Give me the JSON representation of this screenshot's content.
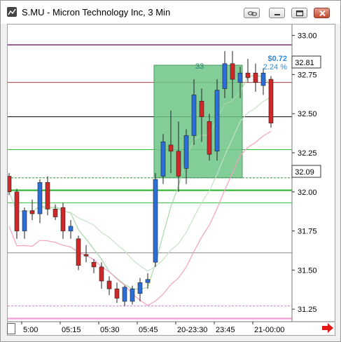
{
  "window": {
    "title": "S.MU - Micron Technology Inc, 3 Min"
  },
  "titlebar_buttons": [
    {
      "name": "link-icon-button",
      "icon": "chain-link-icon"
    },
    {
      "name": "minimize-button",
      "icon": "minimize-icon"
    },
    {
      "name": "maximize-button",
      "icon": "maximize-icon"
    },
    {
      "name": "close-button",
      "icon": "close-icon"
    }
  ],
  "colors": {
    "up_candle": "#2a6fd8",
    "down_candle": "#d02828",
    "box_fill": "#6cc486",
    "current_price_bg": "#ffffff",
    "price_badge_bg": "#3c3c3c",
    "nav_arrow": "#e01818",
    "info_text": "#2a8be0"
  },
  "price_axis": {
    "ticks": [
      "33.00",
      "32.75",
      "32.50",
      "32.25",
      "32.00",
      "31.75",
      "31.50",
      "31.25"
    ]
  },
  "time_axis": {
    "ticks": [
      "5:00",
      "05:15",
      "05:30",
      "05:45",
      "20-23:30",
      "23:45",
      "21-00:00"
    ]
  },
  "labels": {
    "current_price": "32.81",
    "level_price": "32.09",
    "box_bar_count": "33",
    "change_dollar": "$0.72",
    "change_percent": "2.24 %"
  },
  "chart_data": {
    "type": "candlestick",
    "symbol": "S.MU",
    "interval": "3 Min",
    "ylim": [
      31.17,
      33.07
    ],
    "candles": [
      {
        "o": 32.1,
        "h": 32.12,
        "l": 31.98,
        "c": 32.0
      },
      {
        "o": 32.0,
        "h": 32.02,
        "l": 31.7,
        "c": 31.75
      },
      {
        "o": 31.75,
        "h": 31.9,
        "l": 31.7,
        "c": 31.88
      },
      {
        "o": 31.88,
        "h": 31.95,
        "l": 31.82,
        "c": 31.86
      },
      {
        "o": 31.86,
        "h": 32.08,
        "l": 31.8,
        "c": 32.06
      },
      {
        "o": 32.06,
        "h": 32.1,
        "l": 31.85,
        "c": 31.89
      },
      {
        "o": 31.89,
        "h": 31.92,
        "l": 31.82,
        "c": 31.84
      },
      {
        "o": 31.9,
        "h": 31.93,
        "l": 31.7,
        "c": 31.75
      },
      {
        "o": 31.75,
        "h": 31.82,
        "l": 31.7,
        "c": 31.78
      },
      {
        "o": 31.7,
        "h": 31.72,
        "l": 31.5,
        "c": 31.53
      },
      {
        "o": 31.6,
        "h": 31.66,
        "l": 31.55,
        "c": 31.59
      },
      {
        "o": 31.55,
        "h": 31.57,
        "l": 31.48,
        "c": 31.52
      },
      {
        "o": 31.52,
        "h": 31.55,
        "l": 31.38,
        "c": 31.43
      },
      {
        "o": 31.43,
        "h": 31.46,
        "l": 31.34,
        "c": 31.38
      },
      {
        "o": 31.38,
        "h": 31.42,
        "l": 31.29,
        "c": 31.32
      },
      {
        "o": 31.3,
        "h": 31.4,
        "l": 31.27,
        "c": 31.39
      },
      {
        "o": 31.3,
        "h": 31.4,
        "l": 31.28,
        "c": 31.38
      },
      {
        "o": 31.35,
        "h": 31.45,
        "l": 31.3,
        "c": 31.42
      },
      {
        "o": 31.42,
        "h": 31.48,
        "l": 31.38,
        "c": 31.44
      },
      {
        "o": 31.55,
        "h": 32.12,
        "l": 31.52,
        "c": 32.08
      },
      {
        "o": 32.1,
        "h": 32.37,
        "l": 32.05,
        "c": 32.32
      },
      {
        "o": 32.3,
        "h": 32.52,
        "l": 32.12,
        "c": 32.26
      },
      {
        "o": 32.26,
        "h": 32.45,
        "l": 32.0,
        "c": 32.1
      },
      {
        "o": 32.15,
        "h": 32.4,
        "l": 32.05,
        "c": 32.36
      },
      {
        "o": 32.36,
        "h": 32.72,
        "l": 32.3,
        "c": 32.62
      },
      {
        "o": 32.58,
        "h": 32.66,
        "l": 32.32,
        "c": 32.48
      },
      {
        "o": 32.45,
        "h": 32.5,
        "l": 32.2,
        "c": 32.24
      },
      {
        "o": 32.26,
        "h": 32.72,
        "l": 32.2,
        "c": 32.65
      },
      {
        "o": 32.66,
        "h": 32.9,
        "l": 32.6,
        "c": 32.82
      },
      {
        "o": 32.82,
        "h": 32.9,
        "l": 32.6,
        "c": 32.72
      },
      {
        "o": 32.7,
        "h": 32.8,
        "l": 32.6,
        "c": 32.76
      },
      {
        "o": 32.76,
        "h": 32.85,
        "l": 32.7,
        "c": 32.73
      },
      {
        "o": 32.76,
        "h": 32.82,
        "l": 32.64,
        "c": 32.7
      },
      {
        "o": 32.68,
        "h": 32.79,
        "l": 32.62,
        "c": 32.76
      },
      {
        "o": 32.72,
        "h": 32.74,
        "l": 32.41,
        "c": 32.44
      }
    ],
    "horizontal_levels": [
      {
        "price": 32.94,
        "color": "#7a2a7a",
        "width": 1.5
      },
      {
        "price": 32.7,
        "color": "#b04040",
        "width": 1
      },
      {
        "price": 32.48,
        "color": "#000000",
        "width": 1
      },
      {
        "price": 32.27,
        "color": "#30c030",
        "width": 1
      },
      {
        "price": 32.09,
        "color": "#30a030",
        "width": 1,
        "dash": true
      },
      {
        "price": 32.01,
        "color": "#20b020",
        "width": 2
      },
      {
        "price": 31.93,
        "color": "#30c030",
        "width": 1
      },
      {
        "price": 31.61,
        "color": "#888888",
        "width": 1
      },
      {
        "price": 31.27,
        "color": "#d080d0",
        "width": 1,
        "dash": true
      },
      {
        "price": 31.19,
        "color": "#ff90d0",
        "width": 2
      }
    ],
    "box": {
      "start_index": 19,
      "end_index": 29,
      "high": 32.81,
      "low": 32.09
    }
  }
}
